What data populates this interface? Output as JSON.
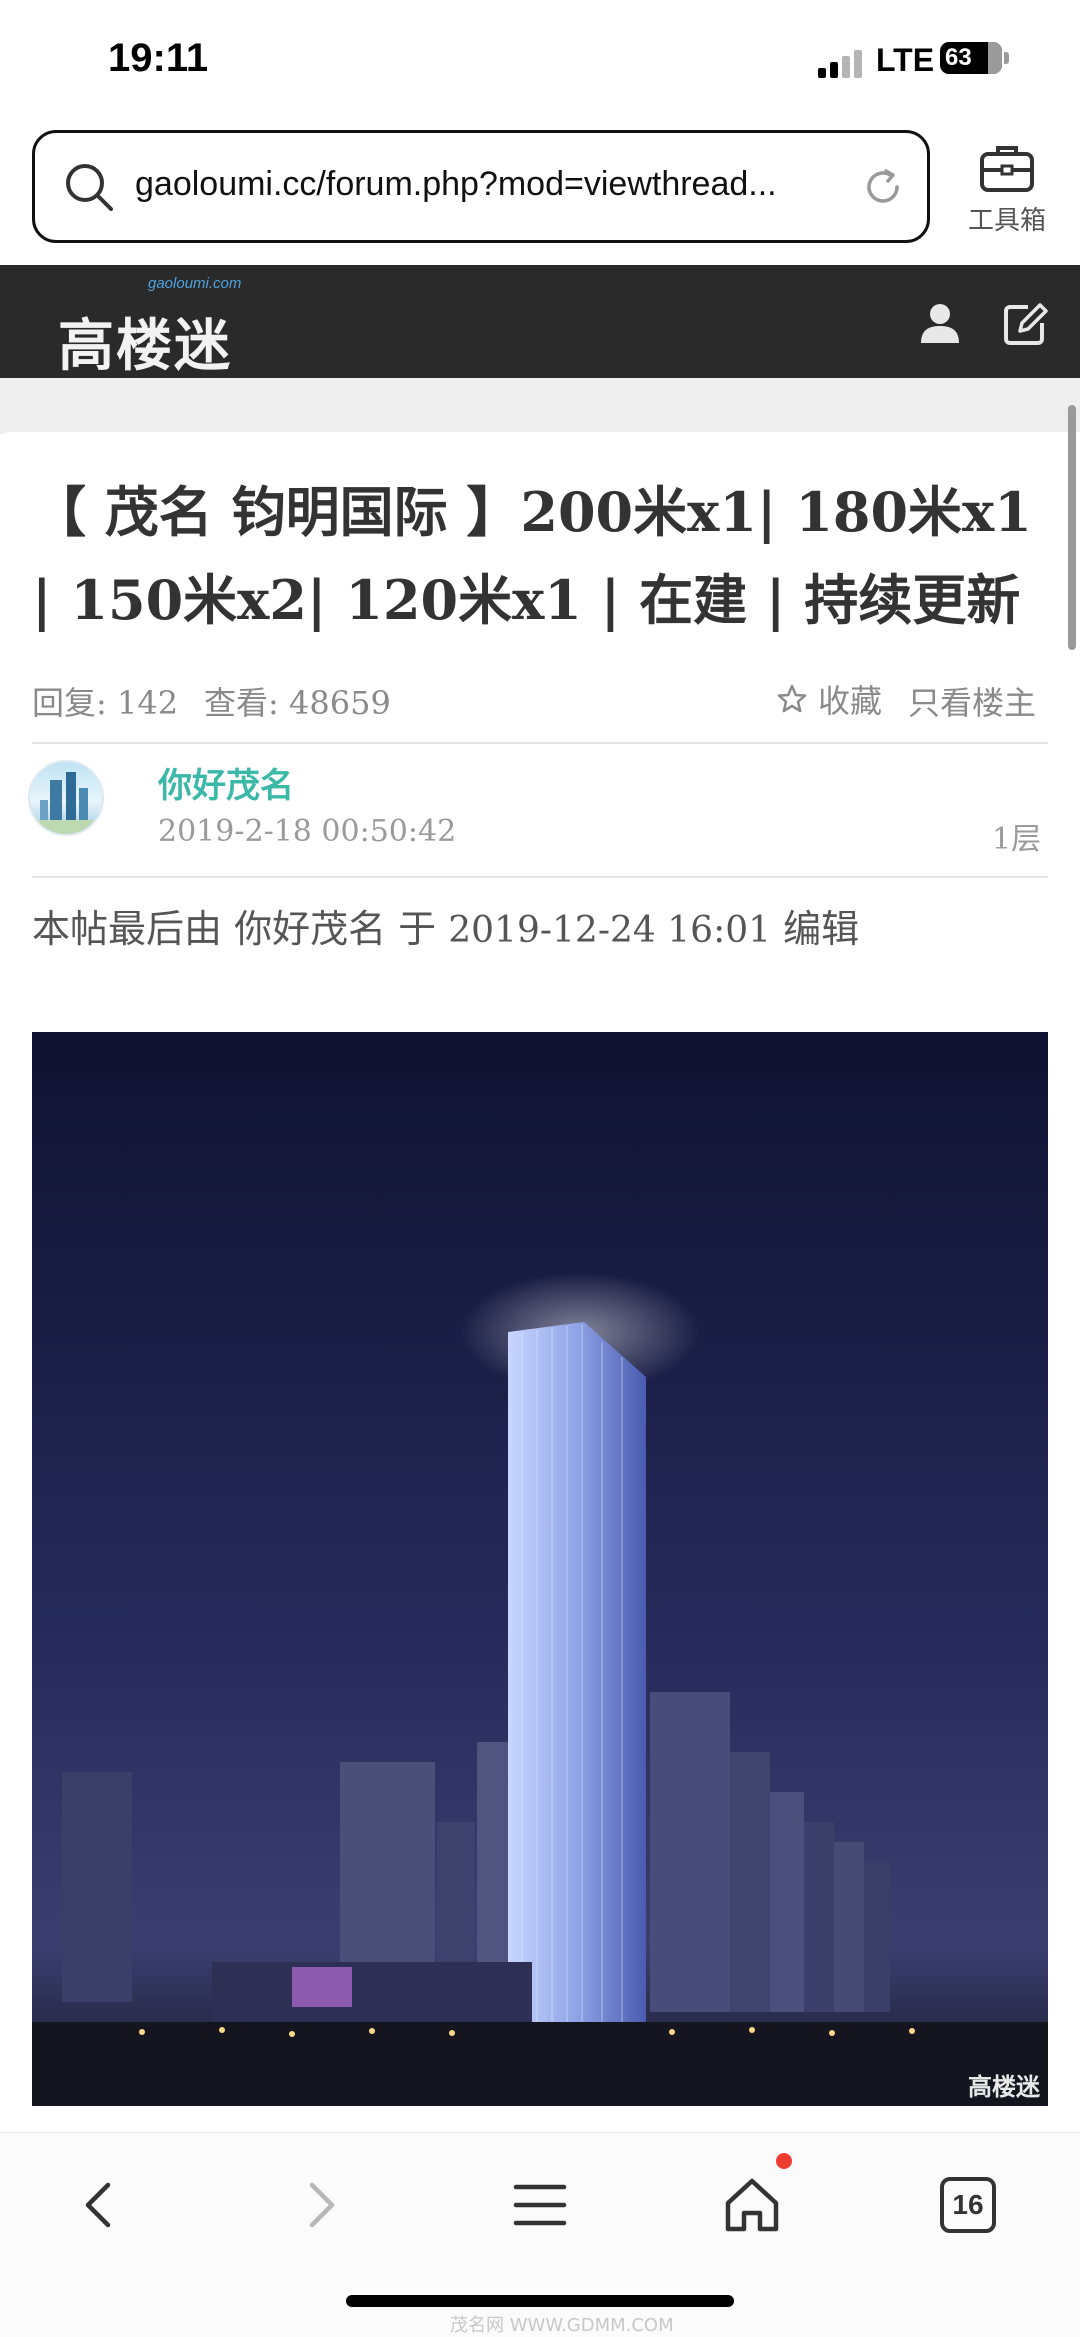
{
  "status_bar": {
    "time": "19:11",
    "network": "LTE",
    "battery": "63"
  },
  "browser": {
    "url": "gaoloumi.cc/forum.php?mod=viewthread...",
    "toolbox_label": "工具箱"
  },
  "site": {
    "logo_text": "高楼迷",
    "logo_sub": "gaoloumi.com"
  },
  "thread": {
    "title": "【 茂名 钧明国际 】200米x1| 180米x1 | 150米x2| 120米x1 | 在建 | 持续更新",
    "replies_label": "回复:",
    "replies": "142",
    "views_label": "查看:",
    "views": "48659",
    "favorite_label": "收藏",
    "only_host_label": "只看楼主"
  },
  "post": {
    "author": "你好茂名",
    "time": "2019-2-18 00:50:42",
    "floor": "1层",
    "edit_prefix": "本帖最后由 你好茂名 于 ",
    "edit_time": "2019-12-24 16:01",
    "edit_suffix": " 编辑",
    "image_watermark": "高楼迷"
  },
  "bottom_nav": {
    "tab_count": "16",
    "watermark": "茂名网 WWW.GDMM.COM"
  },
  "colors": {
    "header_bg": "#2a2a2a",
    "author": "#3cb8a8",
    "notification_dot": "#ee3b2f"
  },
  "icons": [
    "search-icon",
    "reload-icon",
    "toolbox-icon",
    "user-icon",
    "edit-icon",
    "star-icon",
    "back-icon",
    "forward-icon",
    "menu-icon",
    "home-icon"
  ]
}
